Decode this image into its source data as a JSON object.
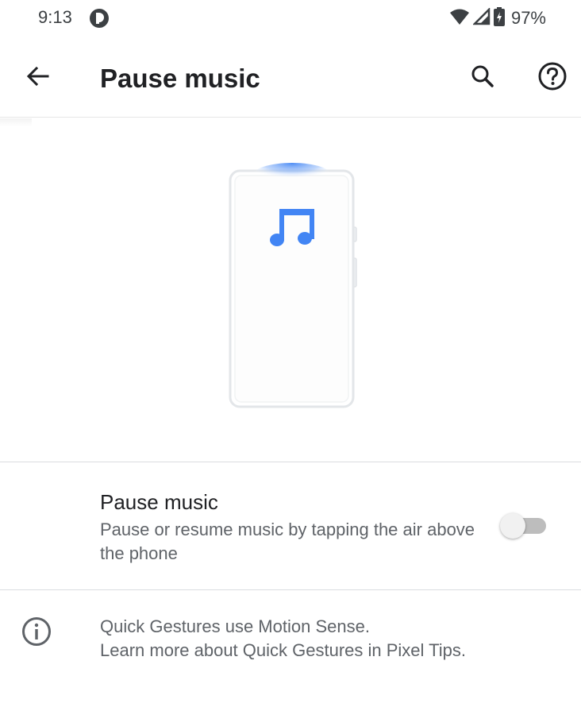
{
  "status_bar": {
    "time": "9:13",
    "battery_percent": "97%",
    "icons": [
      "notification-icon",
      "wifi-icon",
      "cellular-signal-icon",
      "battery-icon"
    ]
  },
  "app_bar": {
    "title": "Pause music",
    "icons": [
      "back-arrow-icon",
      "search-icon",
      "help-icon"
    ]
  },
  "illustration": {
    "icon": "music-note-icon",
    "accent_color": "#4285f4"
  },
  "setting": {
    "title": "Pause music",
    "summary": "Pause or resume music by tapping the air above the phone",
    "enabled": false
  },
  "info": {
    "icon": "info-icon",
    "line1": "Quick Gestures use Motion Sense.",
    "line2": "Learn more about Quick Gestures in Pixel Tips."
  },
  "colors": {
    "primary_text": "#202124",
    "secondary_text": "#5f6368",
    "divider": "#dadce0",
    "accent": "#4285f4"
  }
}
